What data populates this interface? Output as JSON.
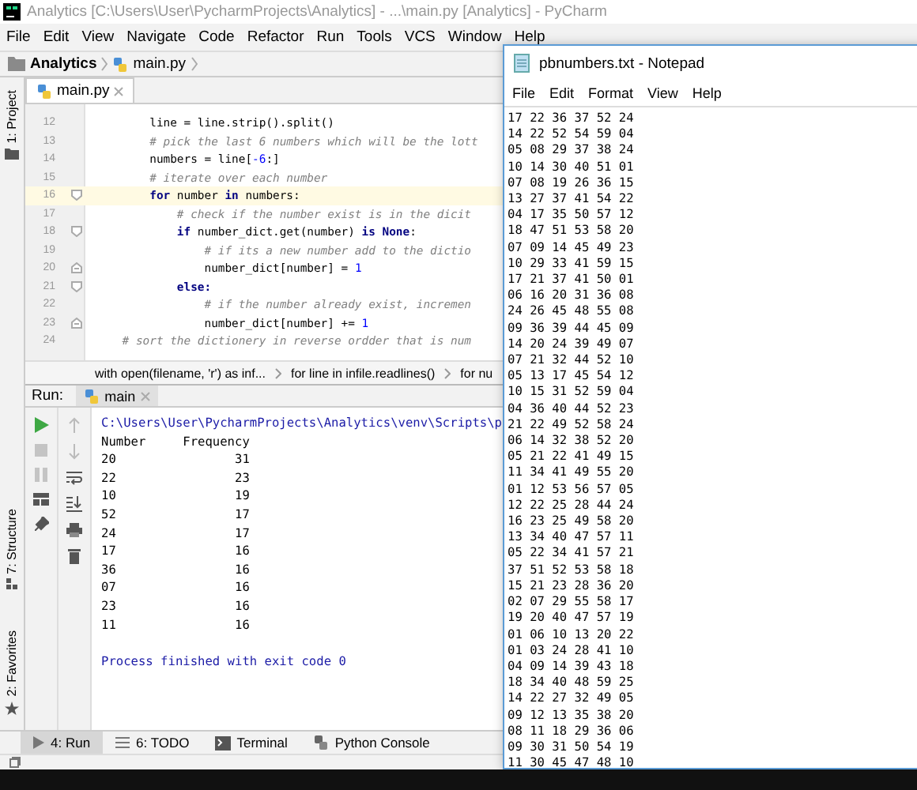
{
  "pycharm": {
    "title": "Analytics [C:\\Users\\User\\PycharmProjects\\Analytics] - ...\\main.py [Analytics] - PyCharm",
    "menu": [
      "File",
      "Edit",
      "View",
      "Navigate",
      "Code",
      "Refactor",
      "Run",
      "Tools",
      "VCS",
      "Window",
      "Help"
    ],
    "nav": [
      "Analytics",
      "main.py"
    ],
    "side_tabs_top": [
      "1: Project"
    ],
    "side_tabs_bottom": [
      "7: Structure",
      "2: Favorites"
    ],
    "editor_tabs": [
      {
        "label": "main.py",
        "selected": true
      }
    ],
    "code_lines": [
      {
        "number": "12",
        "current": false,
        "tokens": [
          {
            "kind": "plain",
            "text": "        line = line.strip().split()"
          }
        ]
      },
      {
        "number": "13",
        "current": false,
        "tokens": [
          {
            "kind": "comment",
            "text": "        # pick the last 6 numbers which will be the lott"
          }
        ]
      },
      {
        "number": "14",
        "current": false,
        "tokens": [
          {
            "kind": "plain",
            "text": "        numbers = line["
          },
          {
            "kind": "number",
            "text": "-6"
          },
          {
            "kind": "plain",
            "text": ":]"
          }
        ]
      },
      {
        "number": "15",
        "current": false,
        "tokens": [
          {
            "kind": "comment",
            "text": "        # iterate over each number"
          }
        ]
      },
      {
        "number": "16",
        "current": true,
        "fold_start": true,
        "tokens": [
          {
            "kind": "keyword",
            "text": "        for"
          },
          {
            "kind": "plain",
            "text": " number "
          },
          {
            "kind": "keyword",
            "text": "in"
          },
          {
            "kind": "plain",
            "text": " numbers:"
          }
        ]
      },
      {
        "number": "17",
        "current": false,
        "tokens": [
          {
            "kind": "comment",
            "text": "            # check if the number exist is in the dicit"
          }
        ]
      },
      {
        "number": "18",
        "current": false,
        "fold_start": true,
        "tokens": [
          {
            "kind": "keyword",
            "text": "            if"
          },
          {
            "kind": "plain",
            "text": " number_dict.get(number) "
          },
          {
            "kind": "keyword",
            "text": "is None"
          },
          {
            "kind": "plain",
            "text": ":"
          }
        ]
      },
      {
        "number": "19",
        "current": false,
        "tokens": [
          {
            "kind": "comment",
            "text": "                # if its a new number add to the dictio"
          }
        ]
      },
      {
        "number": "20",
        "current": false,
        "fold_end": true,
        "tokens": [
          {
            "kind": "plain",
            "text": "                number_dict[number] = "
          },
          {
            "kind": "number",
            "text": "1"
          }
        ]
      },
      {
        "number": "21",
        "current": false,
        "fold_start": true,
        "tokens": [
          {
            "kind": "keyword",
            "text": "            else:"
          }
        ]
      },
      {
        "number": "22",
        "current": false,
        "tokens": [
          {
            "kind": "comment",
            "text": "                # if the number already exist, incremen"
          }
        ]
      },
      {
        "number": "23",
        "current": false,
        "fold_end": true,
        "tokens": [
          {
            "kind": "plain",
            "text": "                number_dict[number] += "
          },
          {
            "kind": "number",
            "text": "1"
          }
        ]
      },
      {
        "number": "24",
        "current": false,
        "tokens": [
          {
            "kind": "comment",
            "text": "    # sort the dictionery in reverse ordder that is num"
          }
        ]
      }
    ],
    "breadcrumbs": [
      "with open(filename, 'r') as inf...",
      "for line in infile.readlines()",
      "for nu"
    ],
    "run": {
      "label": "Run:",
      "tabs": [
        {
          "label": "main",
          "selected": true
        }
      ],
      "console": [
        {
          "kind": "command",
          "text": "C:\\Users\\User\\PycharmProjects\\Analytics\\venv\\Scripts\\p"
        },
        {
          "kind": "output",
          "text": "Number     Frequency"
        },
        {
          "kind": "output",
          "text": "20                31"
        },
        {
          "kind": "output",
          "text": "22                23"
        },
        {
          "kind": "output",
          "text": "10                19"
        },
        {
          "kind": "output",
          "text": "52                17"
        },
        {
          "kind": "output",
          "text": "24                17"
        },
        {
          "kind": "output",
          "text": "17                16"
        },
        {
          "kind": "output",
          "text": "36                16"
        },
        {
          "kind": "output",
          "text": "07                16"
        },
        {
          "kind": "output",
          "text": "23                16"
        },
        {
          "kind": "output",
          "text": "11                16"
        },
        {
          "kind": "exit",
          "text": "Process finished with exit code 0"
        }
      ]
    },
    "tool_tabs": [
      {
        "label": "4: Run",
        "selected": true,
        "kind": "run"
      },
      {
        "label": "6: TODO",
        "selected": false,
        "kind": "todo"
      },
      {
        "label": "Terminal",
        "selected": false,
        "kind": "terminal"
      },
      {
        "label": "Python Console",
        "selected": false,
        "kind": "python"
      }
    ]
  },
  "notepad": {
    "title": "pbnumbers.txt - Notepad",
    "menu": [
      "File",
      "Edit",
      "Format",
      "View",
      "Help"
    ],
    "lines": [
      "17 22 36 37 52 24",
      "14 22 52 54 59 04",
      "05 08 29 37 38 24",
      "10 14 30 40 51 01",
      "07 08 19 26 36 15",
      "13 27 37 41 54 22",
      "04 17 35 50 57 12",
      "18 47 51 53 58 20",
      "07 09 14 45 49 23",
      "10 29 33 41 59 15",
      "17 21 37 41 50 01",
      "06 16 20 31 36 08",
      "24 26 45 48 55 08",
      "09 36 39 44 45 09",
      "14 20 24 39 49 07",
      "07 21 32 44 52 10",
      "05 13 17 45 54 12",
      "10 15 31 52 59 04",
      "04 36 40 44 52 23",
      "21 22 49 52 58 24",
      "06 14 32 38 52 20",
      "05 21 22 41 49 15",
      "11 34 41 49 55 20",
      "01 12 53 56 57 05",
      "12 22 25 28 44 24",
      "16 23 25 49 58 20",
      "13 34 40 47 57 11",
      "05 22 34 41 57 21",
      "37 51 52 53 58 18",
      "15 21 23 28 36 20",
      "02 07 29 55 58 17",
      "19 20 40 47 57 19",
      "01 06 10 13 20 22",
      "01 03 24 28 41 10",
      "04 09 14 39 43 18",
      "18 34 40 48 59 25",
      "14 22 27 32 49 05",
      "09 12 13 35 38 20",
      "08 11 18 29 36 06",
      "09 30 31 50 54 19",
      "11 30 45 47 48 10"
    ]
  }
}
